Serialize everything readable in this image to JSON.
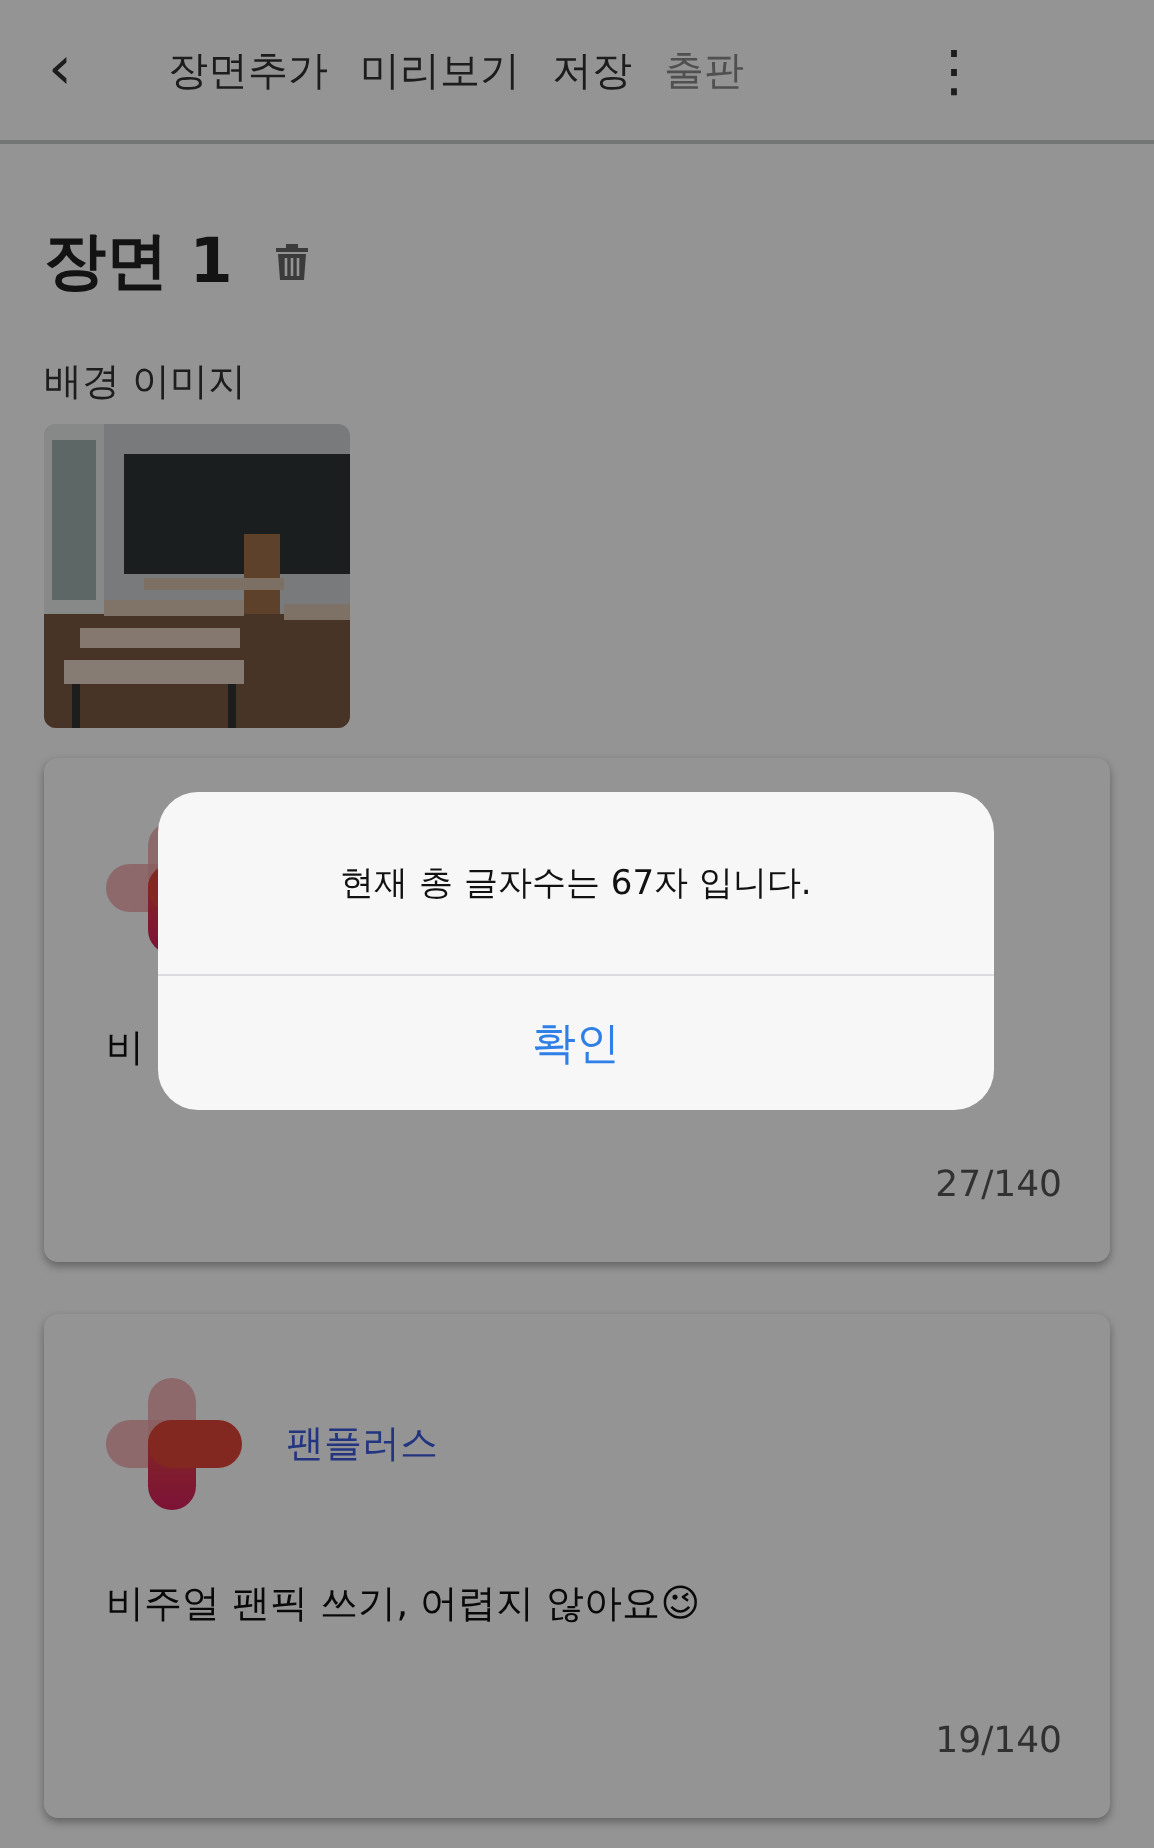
{
  "toolbar": {
    "back": "‹",
    "actions": [
      {
        "label": "장면추가",
        "disabled": false
      },
      {
        "label": "미리보기",
        "disabled": false
      },
      {
        "label": "저장",
        "disabled": false
      },
      {
        "label": "출판",
        "disabled": true
      }
    ],
    "more": "⋮"
  },
  "scene": {
    "title": "장면 1",
    "background_label": "배경 이미지"
  },
  "cards": [
    {
      "text": "비",
      "counter": "27/140"
    },
    {
      "name": "팬플러스",
      "text": "비주얼 팬픽 쓰기, 어렵지 않아요😉",
      "counter": "19/140"
    }
  ],
  "dialog": {
    "message": "현재 총 글자수는 67자 입니다.",
    "button": "확인"
  }
}
